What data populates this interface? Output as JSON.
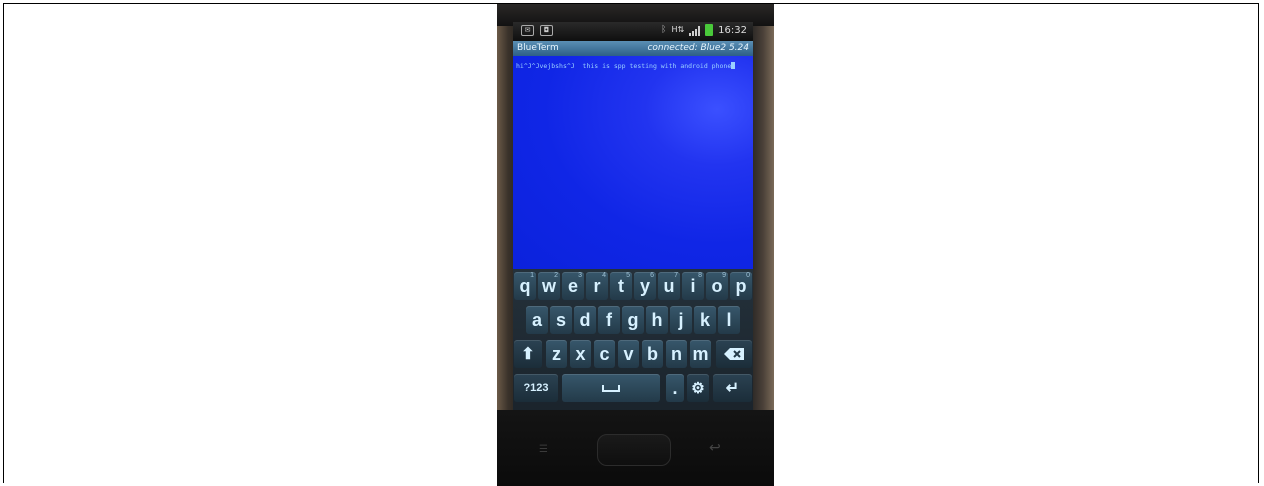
{
  "status_bar": {
    "left_icons": [
      "mail-icon",
      "camera-icon"
    ],
    "right_icons": [
      "bluetooth-icon",
      "data-transfer-icon",
      "signal-icon",
      "battery-icon"
    ],
    "network_label": "H",
    "time": "16:32"
  },
  "app_bar": {
    "title": "BlueTerm",
    "connection_status": "connected: Blue2 5.24"
  },
  "terminal": {
    "text": "hi^J^Jvejbshs^J  this is spp testing with android phone"
  },
  "keyboard": {
    "row1": [
      {
        "label": "q",
        "hint": "1"
      },
      {
        "label": "w",
        "hint": "2"
      },
      {
        "label": "e",
        "hint": "3"
      },
      {
        "label": "r",
        "hint": "4"
      },
      {
        "label": "t",
        "hint": "5"
      },
      {
        "label": "y",
        "hint": "6"
      },
      {
        "label": "u",
        "hint": "7"
      },
      {
        "label": "i",
        "hint": "8"
      },
      {
        "label": "o",
        "hint": "9"
      },
      {
        "label": "p",
        "hint": "0"
      }
    ],
    "row2": [
      "a",
      "s",
      "d",
      "f",
      "g",
      "h",
      "j",
      "k",
      "l"
    ],
    "row3": [
      "z",
      "x",
      "c",
      "v",
      "b",
      "n",
      "m"
    ],
    "symbols_label": "?123",
    "shift_icon": "shift-arrow-icon",
    "backspace_icon": "backspace-icon",
    "space_icon": "spacebar-icon",
    "period_label": ".",
    "settings_icon": "gear-icon",
    "enter_icon": "enter-icon"
  },
  "colors": {
    "terminal_background": "#1026e6",
    "terminal_text": "#9ad0ff",
    "app_bar": "#3f77a0",
    "key_face": "#2d4a5c",
    "key_text": "#d7f1ff",
    "battery": "#49c93a"
  }
}
